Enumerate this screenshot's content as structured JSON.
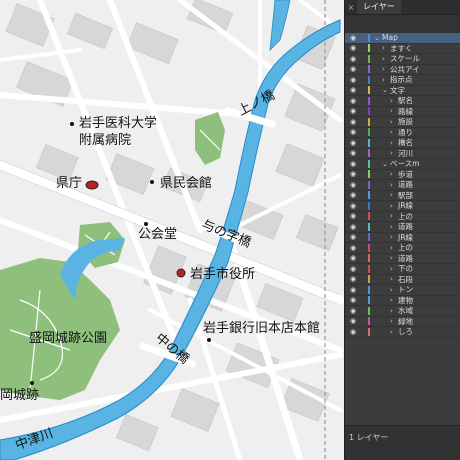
{
  "map": {
    "labels": {
      "kamino_bashi": "上ノ橋",
      "iwate_med_1": "岩手医科大学",
      "iwate_med_2": "附属病院",
      "kencho": "県庁",
      "kenmin_kaikan": "県民会館",
      "yonoji_bashi": "与の字橋",
      "kokaido": "公会堂",
      "shiyakusho": "岩手市役所",
      "morioka_park": "盛岡城跡公園",
      "naka_no_hashi": "中の橋",
      "iwate_bank": "岩手銀行旧本店本館",
      "morioka_castle": "岡城跡",
      "nakatsu_river": "中津川"
    },
    "colors": {
      "background": "#efefef",
      "road": "#ffffff",
      "building": "#d7d7d7",
      "water": "#5ab4e3",
      "water_edge": "#1f8ccf",
      "park": "#8fbf7d",
      "marker": "#c0201f"
    }
  },
  "layers_panel": {
    "tab_label": "レイヤー",
    "close_icon": "×",
    "footer": "1 レイヤー",
    "rows": [
      {
        "name": "Map",
        "color": "#4f8fd8",
        "indent": 0,
        "expanded": true,
        "selected": true
      },
      {
        "name": "ますく",
        "color": "#9cd35a",
        "indent": 1
      },
      {
        "name": "スケール",
        "color": "#6bbd52",
        "indent": 1
      },
      {
        "name": "公共アイ",
        "color": "#7f6ad8",
        "indent": 1
      },
      {
        "name": "指示点",
        "color": "#4a76d6",
        "indent": 1
      },
      {
        "name": "文字",
        "color": "#d5b846",
        "indent": 1,
        "expanded": true
      },
      {
        "name": "駅名",
        "color": "#8c5bd4",
        "indent": 2
      },
      {
        "name": "路線",
        "color": "#7a3fd0",
        "indent": 2
      },
      {
        "name": "施設",
        "color": "#cfa94a",
        "indent": 2
      },
      {
        "name": "通り",
        "color": "#52b14d",
        "indent": 2
      },
      {
        "name": "橋名",
        "color": "#5ab4d6",
        "indent": 2
      },
      {
        "name": "河川",
        "color": "#b45bc9",
        "indent": 2
      },
      {
        "name": "ベースm",
        "color": "#5ac0a0",
        "indent": 1,
        "expanded": true
      },
      {
        "name": "歩道",
        "color": "#84d070",
        "indent": 2
      },
      {
        "name": "道路",
        "color": "#7b60c8",
        "indent": 2
      },
      {
        "name": "駅部",
        "color": "#4c9fd8",
        "indent": 2
      },
      {
        "name": "JR線",
        "color": "#3f6fd0",
        "indent": 2
      },
      {
        "name": "上の",
        "color": "#d04f4f",
        "indent": 2
      },
      {
        "name": "道路",
        "color": "#5bb8c7",
        "indent": 2
      },
      {
        "name": "JR線",
        "color": "#6a5fcb",
        "indent": 2
      },
      {
        "name": "上の",
        "color": "#c84f6c",
        "indent": 2
      },
      {
        "name": "道路",
        "color": "#d07040",
        "indent": 2
      },
      {
        "name": "下の",
        "color": "#c85050",
        "indent": 2
      },
      {
        "name": "石段",
        "color": "#d09a48",
        "indent": 2
      },
      {
        "name": "トン",
        "color": "#5b8bd4",
        "indent": 2
      },
      {
        "name": "建物",
        "color": "#4aa0d0",
        "indent": 2
      },
      {
        "name": "水域",
        "color": "#62c45a",
        "indent": 2
      },
      {
        "name": "緑地",
        "color": "#c05a9a",
        "indent": 2
      },
      {
        "name": "しろ",
        "color": "#d86a7a",
        "indent": 2
      }
    ]
  }
}
